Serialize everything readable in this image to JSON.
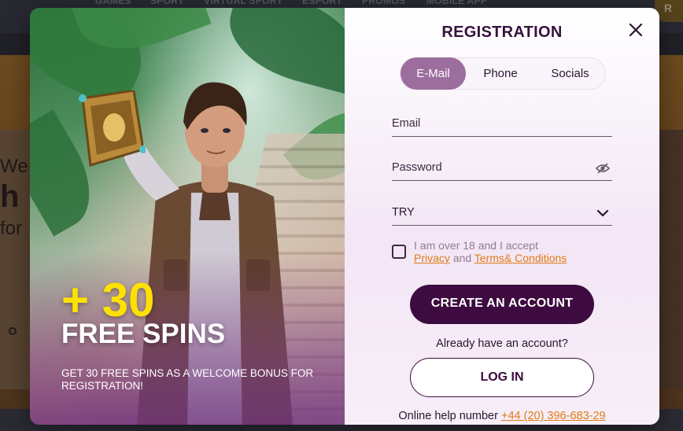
{
  "background": {
    "nav": [
      "GAMES",
      "SPORT",
      "VIRTUAL SPORT",
      "ESPORT",
      "PROMOS",
      "MOBILE APP"
    ],
    "corner_button": "R",
    "hero_lines": [
      "We",
      "h",
      "for"
    ]
  },
  "promo": {
    "bonus_amount": "+ 30",
    "bonus_label": "FREE SPINS",
    "description": "GET 30 FREE SPINS AS A WELCOME BONUS FOR REGISTRATION!"
  },
  "form": {
    "title": "REGISTRATION",
    "tabs": [
      {
        "label": "E-Mail",
        "active": true
      },
      {
        "label": "Phone",
        "active": false
      },
      {
        "label": "Socials",
        "active": false
      }
    ],
    "email_label": "Email",
    "password_label": "Password",
    "currency_value": "TRY",
    "consent_text": "I am over 18 and I accept",
    "privacy_link": "Privacy",
    "consent_and": "and",
    "terms_link": "Terms& Conditions",
    "create_button": "CREATE AN ACCOUNT",
    "have_account": "Already have an account?",
    "login_button": "LOG IN",
    "help_label": "Online help number",
    "help_phone": "+44 (20) 396-683-29"
  },
  "colors": {
    "accent_orange": "#e07b14",
    "primary_purple": "#3d0b3f",
    "tab_active": "#9c6e9e",
    "bonus_yellow": "#ffe100"
  }
}
